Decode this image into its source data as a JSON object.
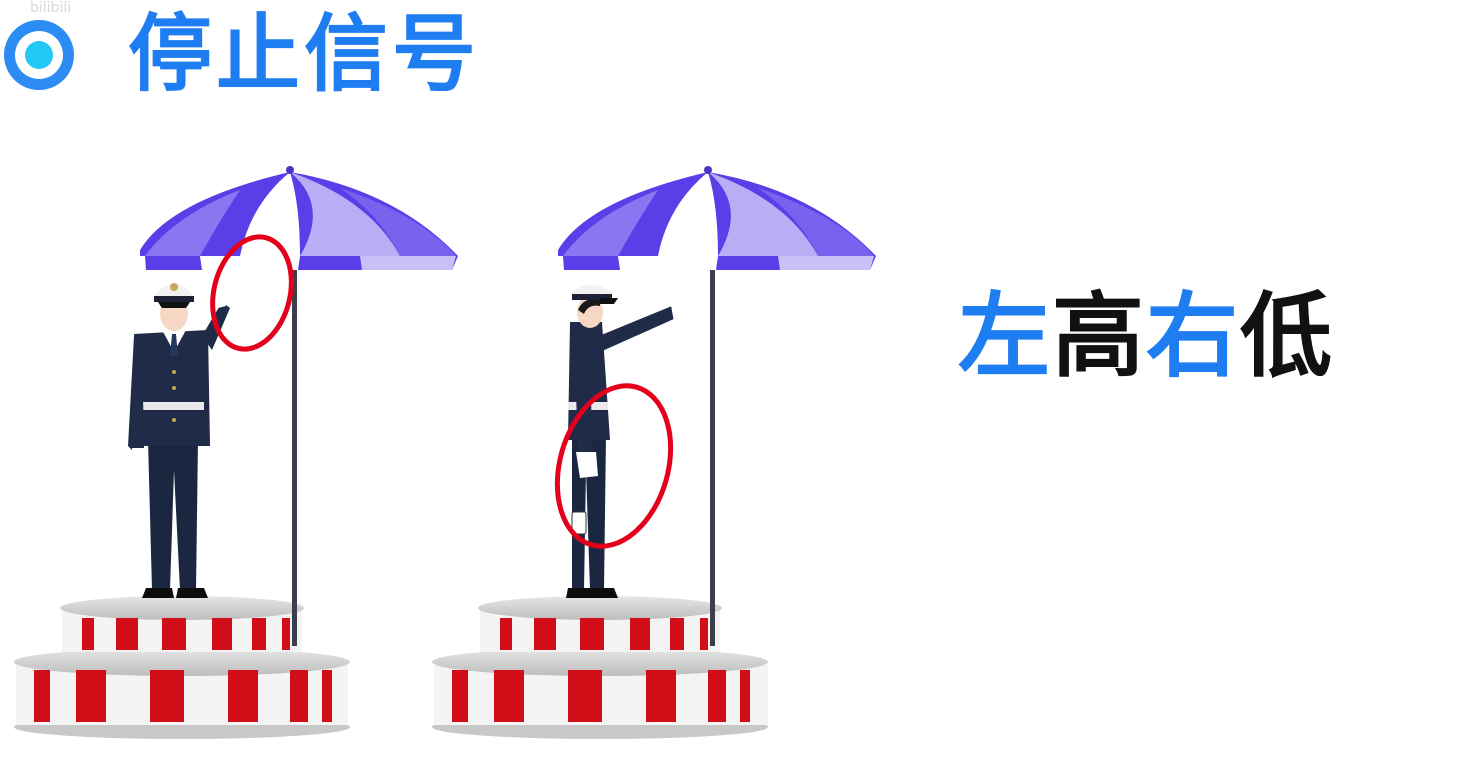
{
  "header": {
    "watermark": "bilibili",
    "title": "停止信号"
  },
  "caption": {
    "chars": [
      {
        "text": "左",
        "color": "blue"
      },
      {
        "text": "高",
        "color": "black"
      },
      {
        "text": "右",
        "color": "blue"
      },
      {
        "text": "低",
        "color": "black"
      }
    ]
  },
  "colors": {
    "title_blue": "#1f7df2",
    "bullet_cyan": "#22c8f6",
    "umbrella_purple": "#5a3ee8",
    "umbrella_light": "#b9aef5",
    "highlight_red": "#e4001b",
    "uniform_navy": "#1b2740",
    "platform_red": "#d20f18"
  },
  "figures": [
    {
      "name": "officer-front",
      "pose": "left arm raised, facing forward"
    },
    {
      "name": "officer-side",
      "pose": "arm extended forward, side view"
    }
  ]
}
